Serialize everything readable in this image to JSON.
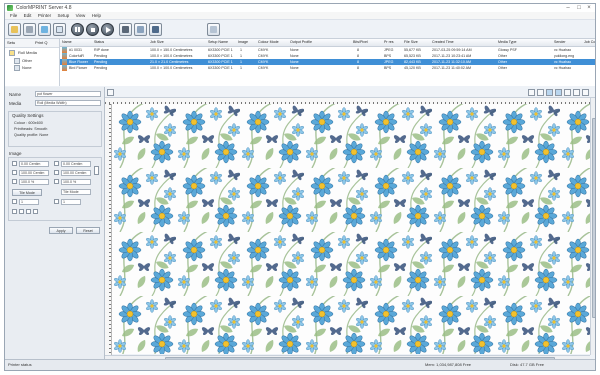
{
  "app": {
    "title": "ColorMPRINT Server 4.8"
  },
  "menu": [
    "File",
    "Edit",
    "Printer",
    "Setup",
    "View",
    "Help"
  ],
  "toolbar": {
    "buttons": [
      "open-file",
      "print",
      "hotfolder",
      "print-preview",
      "pause",
      "stop",
      "play",
      "thumbnails",
      "settings",
      "exit"
    ]
  },
  "tree": {
    "header": [
      "Setu",
      "Print Q"
    ],
    "items": [
      "Roll Media",
      "Other",
      "None"
    ]
  },
  "jobs": {
    "columns": [
      "Name",
      "Status",
      "Job Size",
      "Setup Name",
      "Image",
      "Colour Mode",
      "Output Profile",
      "Bits/Pixel",
      "Pr res",
      "File Size",
      "Created Time",
      "Media Type",
      "Sender",
      "Job Co"
    ],
    "rows": [
      {
        "name": "#1 0031",
        "status": "RIP done",
        "size": "100.0 × 150.0 Centimetres",
        "setup": "6X3300 PCIE 1",
        "image": "1",
        "mode": "CMYK",
        "profile": "None",
        "bits": "8",
        "res": "JPEG",
        "file": "55,677 KB",
        "time": "2017-03-25 09:59:14 AM",
        "media": "Glossy PSF",
        "sender": "vc Huahao"
      },
      {
        "name": "ColorfulR",
        "status": "Pending",
        "size": "100.0 × 100.0 Centimetres",
        "setup": "6X3300 PCIE 1",
        "image": "1",
        "mode": "CMYK",
        "profile": "None",
        "bits": "8",
        "res": "BPS",
        "file": "65,523 KB",
        "time": "2017-11-23 10:23:41 AM",
        "media": "Other",
        "sender": "yukilong.eng"
      },
      {
        "name": "Blue Flower",
        "status": "Pending",
        "size": "21.0 × 21.0 Centimetres",
        "setup": "6X3300 PCIE 1",
        "image": "1",
        "mode": "CMYK",
        "profile": "None",
        "bits": "8",
        "res": "JPEG",
        "file": "82,443 KB",
        "time": "2017-11-23 11:32:10 AM",
        "media": "Other",
        "sender": "vc Huahao"
      },
      {
        "name": "Bird Flower",
        "status": "Pending",
        "size": "100.0 × 100.0 Centimetres",
        "setup": "6X3300 PCIE 1",
        "image": "1",
        "mode": "CMYK",
        "profile": "None",
        "bits": "8",
        "res": "BPS",
        "file": "45,120 KB",
        "time": "2017-11-23 11:40:02 AM",
        "media": "Other",
        "sender": "vc Huahao"
      }
    ]
  },
  "props": {
    "name_label": "Name",
    "name_value": "pot flower",
    "media_label": "Media",
    "media_value": "Roll (Media Width)",
    "quality_label": "Quality Settings",
    "quality_lines": [
      "Colour : 600x600",
      "Printheads: Smooth",
      "Quality profile: None"
    ],
    "image_label": "Image",
    "fields": [
      "0.00 Centim",
      "0.00 Centim",
      "100.00 Centim",
      "100.00 Centim",
      "100.0 %",
      "100.0 %",
      "1",
      "1"
    ],
    "tile_label": "Tile Mode",
    "tile_value": "Tile Mode",
    "buttons": [
      "Apply",
      "Reset"
    ]
  },
  "status": {
    "left": "Printer status",
    "center": "Mem: 1,034,987,808 Free",
    "right": "Disk: 47.7 GB Free"
  },
  "colors": {
    "selection": "#3f8fd6",
    "flower_blue": "#5aa8d8",
    "flower_center": "#f2c12e",
    "leaf_green": "#9bbf86",
    "butterfly": "#35507a"
  }
}
